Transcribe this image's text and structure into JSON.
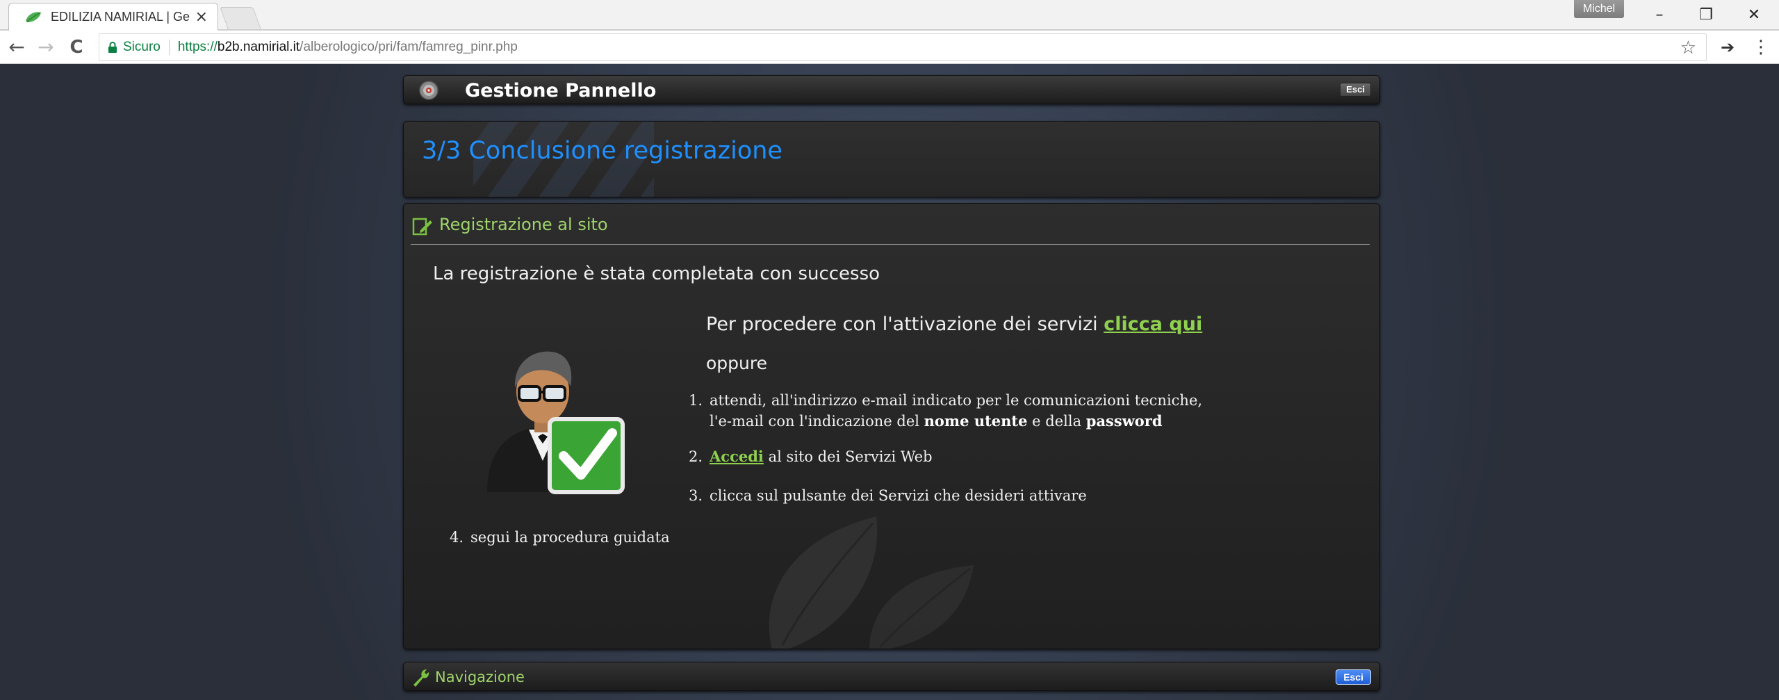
{
  "browser": {
    "tab_title": "EDILIZIA NAMIRIAL | Ges",
    "tab_close": "×",
    "profile_name": "Michel",
    "minimize": "–",
    "restore": "❐",
    "close": "✕",
    "back": "←",
    "forward": "→",
    "reload": "C",
    "secure_label": "Sicuro",
    "url_scheme": "https://",
    "url_host": "b2b.namirial.it",
    "url_path": "/alberologico/pri/fam/famreg_pinr.php",
    "bookmark_star": "☆",
    "share_arrow": "➔",
    "menu_dots": "⋮"
  },
  "header": {
    "title": "Gestione Pannello",
    "esci_label": "Esci"
  },
  "step": {
    "title": "3/3 Conclusione registrazione"
  },
  "content": {
    "section_title": "Registrazione al sito",
    "success_heading": "La registrazione è stata completata con successo",
    "proceed_text": "Per procedere con l'attivazione dei servizi ",
    "proceed_link": "clicca qui",
    "oppure": "oppure",
    "steps": [
      {
        "num": "1.",
        "line1": "attendi, all'indirizzo e-mail indicato per le comunicazioni tecniche,",
        "line2_pre": "l'e-mail con l'indicazione del ",
        "bold1": "nome utente",
        "line2_mid": " e della ",
        "bold2": "password"
      },
      {
        "num": "2.",
        "link": "Accedi",
        "text": " al sito dei Servizi Web"
      },
      {
        "num": "3.",
        "text": "clicca sul pulsante dei Servizi che desideri attivare"
      },
      {
        "num": "4.",
        "text": "segui la procedura guidata"
      }
    ]
  },
  "navigation": {
    "title": "Navigazione",
    "esci_label": "Esci"
  },
  "colors": {
    "accent_blue": "#1e90ff",
    "section_green": "#9fd36b",
    "link_green": "#8fd14f",
    "panel_dark": "#262626",
    "page_bg": "#353f50"
  }
}
